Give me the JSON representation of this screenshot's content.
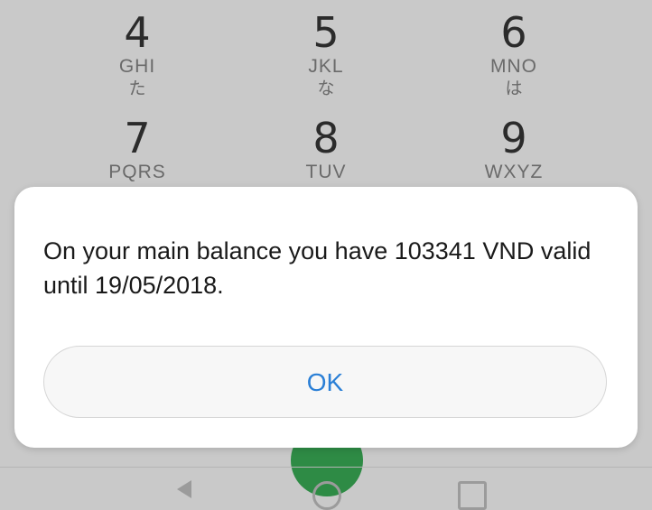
{
  "keypad": {
    "keys": [
      {
        "digit": "4",
        "letters": "GHI",
        "kana": "た"
      },
      {
        "digit": "5",
        "letters": "JKL",
        "kana": "な"
      },
      {
        "digit": "6",
        "letters": "MNO",
        "kana": "は"
      },
      {
        "digit": "7",
        "letters": "PQRS",
        "kana": ""
      },
      {
        "digit": "8",
        "letters": "TUV",
        "kana": ""
      },
      {
        "digit": "9",
        "letters": "WXYZ",
        "kana": ""
      }
    ]
  },
  "dialog": {
    "message": "On your main balance you have 103341 VND valid until 19/05/2018.",
    "ok_label": "OK"
  },
  "colors": {
    "accent": "#2a7fd6",
    "call_button": "#2e8b45",
    "overlay_background": "#c9c9c9"
  },
  "icons": {
    "nav_back": "back-triangle-icon",
    "nav_home": "home-circle-icon",
    "nav_recents": "recents-square-icon"
  }
}
